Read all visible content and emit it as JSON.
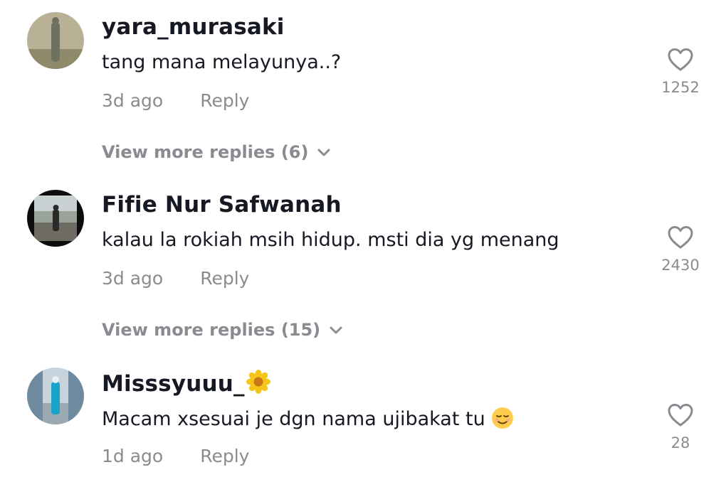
{
  "comments": [
    {
      "username": "yara_murasaki",
      "text": "tang mana melayunya..?",
      "time": "3d ago",
      "reply_label": "Reply",
      "likes": "1252",
      "view_more": "View more replies (6)"
    },
    {
      "username": "Fifie Nur Safwanah",
      "text": "kalau la rokiah msih hidup. msti dia yg menang",
      "time": "3d ago",
      "reply_label": "Reply",
      "likes": "2430",
      "view_more": "View more replies (15)"
    },
    {
      "username": "Misssyuuu_",
      "text": "Macam xsesuai je dgn nama ujibakat tu",
      "time": "1d ago",
      "reply_label": "Reply",
      "likes": "28"
    }
  ],
  "icons": {
    "like": "heart-outline-icon",
    "expand": "chevron-down-icon",
    "username_emoji": "sunflower-emoji",
    "text_emoji": "relieved-face-emoji"
  },
  "colors": {
    "primary_text": "#161823",
    "secondary_text": "#8a8b91",
    "background": "#ffffff"
  }
}
